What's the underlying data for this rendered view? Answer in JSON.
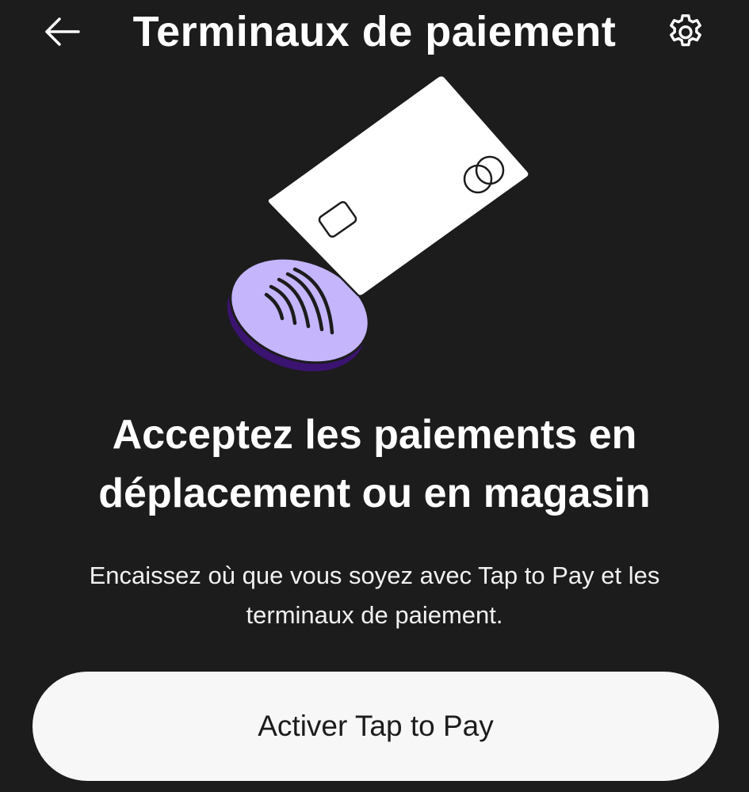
{
  "header": {
    "title": "Terminaux de paiement",
    "back_icon": "arrow-left-icon",
    "settings_icon": "gear-icon"
  },
  "illustration": {
    "card_icon": "payment-card-icon",
    "reader_icon": "contactless-reader-icon",
    "colors": {
      "card": "#ffffff",
      "reader_top": "#c4b5fd",
      "reader_side": "#3b1370",
      "outline": "#1c1c1c"
    }
  },
  "main": {
    "headline": "Acceptez les paiements en déplacement ou en magasin",
    "description": "Encaissez où que vous soyez avec Tap to Pay et les terminaux de paiement."
  },
  "cta": {
    "label": "Activer Tap to Pay"
  },
  "theme": {
    "background": "#1c1c1c",
    "text": "#ffffff",
    "button_bg": "#f7f7f7",
    "button_text": "#1c1c1c"
  }
}
